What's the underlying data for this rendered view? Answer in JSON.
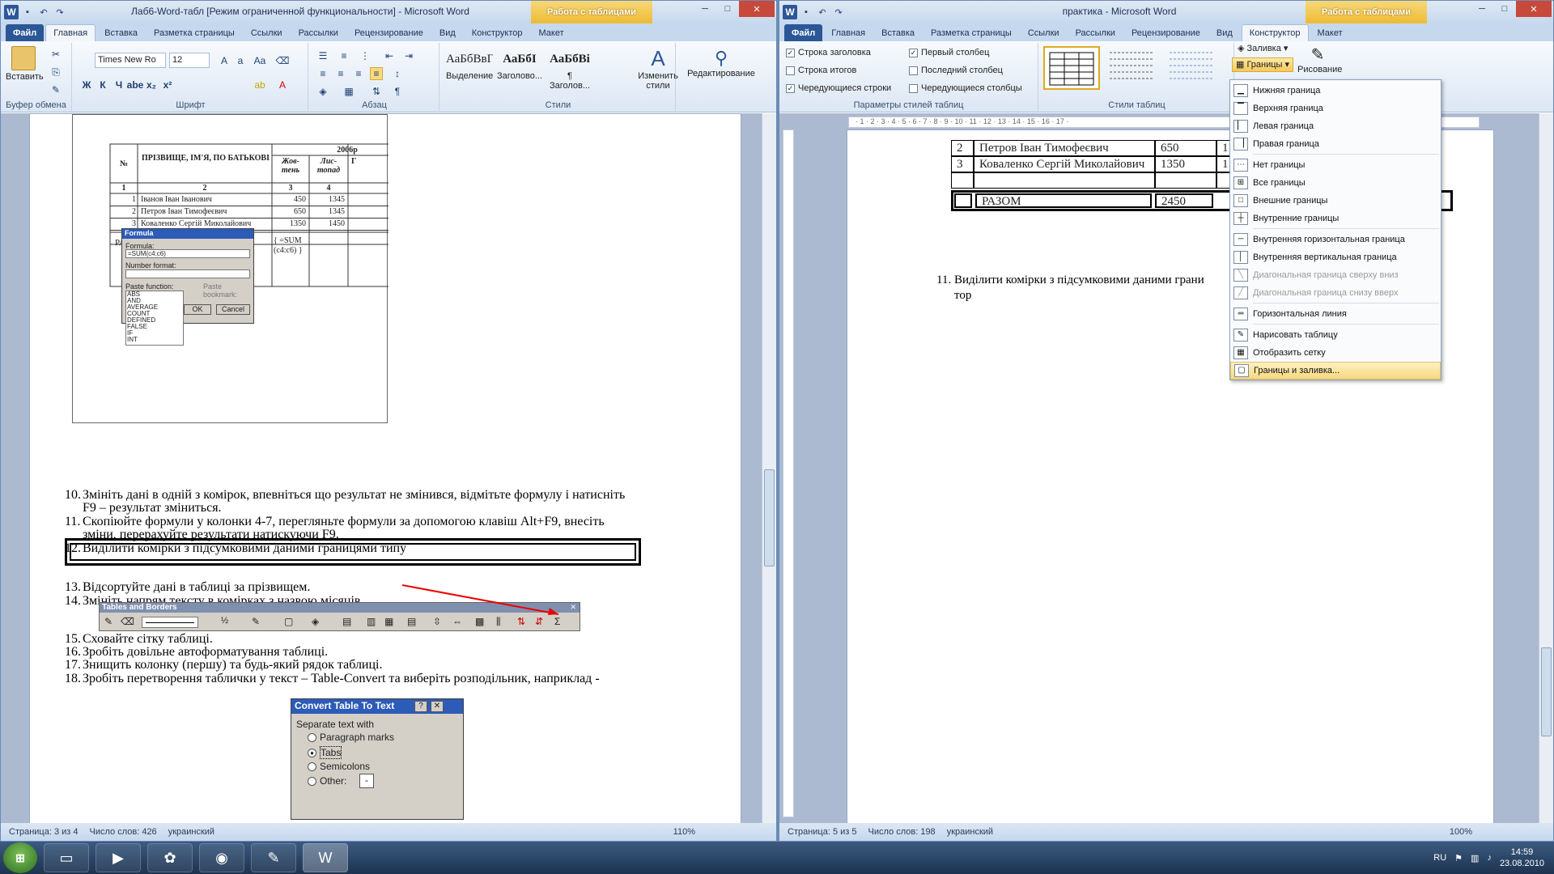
{
  "left": {
    "title": "Лаб6-Word-табл [Режим ограниченной функциональности] - Microsoft Word",
    "context_tab": "Работа с таблицами",
    "tabs": [
      "Файл",
      "Главная",
      "Вставка",
      "Разметка страницы",
      "Ссылки",
      "Рассылки",
      "Рецензирование",
      "Вид",
      "Конструктор",
      "Макет"
    ],
    "ribbon": {
      "paste": "Вставить",
      "clipboard_group": "Буфер обмена",
      "font_name": "Times New Ro",
      "font_size": "12",
      "font_group": "Шрифт",
      "paragraph_group": "Абзац",
      "styles_group": "Стили",
      "styles": [
        {
          "sample": "АаБбВвГ",
          "name": "Выделение"
        },
        {
          "sample": "АаБбІ",
          "name": "Заголово..."
        },
        {
          "sample": "АаБбВі",
          "name": "¶ Заголов..."
        }
      ],
      "change_styles": "Изменить стили",
      "editing": "Редактирование",
      "font_btns": [
        "Ж",
        "К",
        "Ч",
        "abe",
        "x₂",
        "x²"
      ]
    },
    "table": {
      "year": "2006р",
      "h_no": "№",
      "h_name": "ПРІЗВИЩЕ, ІМ'Я, ПО БАТЬКОВІ",
      "h_oct": "Жов-тень",
      "h_nov": "Лис-топад",
      "h_g": "Г",
      "nums": [
        "1",
        "2",
        "3",
        "4"
      ],
      "rows": [
        [
          "1",
          "Іванов Іван Іванович",
          "450",
          "1345"
        ],
        [
          "2",
          "Петров Іван Тимофеєвич",
          "650",
          "1345"
        ],
        [
          "3",
          "Коваленко Сергій Миколайович",
          "1350",
          "1450"
        ]
      ],
      "total": "РАЗОМ",
      "formula_field": "{ =SUM (c4:c6) }"
    },
    "formula_dialog": {
      "title": "Formula",
      "formula_label": "Formula:",
      "formula_value": "=SUM(c4:c6)",
      "number_format": "Number format:",
      "paste_function": "Paste function:",
      "paste_bookmark": "Paste bookmark:",
      "ok": "OK",
      "cancel": "Cancel",
      "functions": [
        "ABS",
        "AND",
        "AVERAGE",
        "COUNT",
        "DEFINED",
        "FALSE",
        "IF",
        "INT"
      ]
    },
    "steps": [
      {
        "n": "10.",
        "t": "Змініть дані в одній з комірок, впевніться що результат не змінився, відмітьте формулу і натисніть"
      },
      {
        "n": "",
        "t": "F9 – результат зміниться."
      },
      {
        "n": "11.",
        "t": "Скопіюйте формули у колонки 4-7, перегляньте формули за допомогою клавіш Alt+F9,  внесіть"
      },
      {
        "n": "",
        "t": "зміни, перерахуйте результати натискуючи F9."
      },
      {
        "n": "12.",
        "t": "Виділити комірки з підсумковими даними границями типу"
      },
      {
        "n": "13.",
        "t": "Відсортуйте дані в таблиці за прізвищем."
      },
      {
        "n": "14.",
        "t": "Змініть напрям тексту в комірках з назвою місяців."
      },
      {
        "n": "15.",
        "t": "Сховайте сітку таблиці."
      },
      {
        "n": "16.",
        "t": "Зробіть довільне автоформатування таблиці."
      },
      {
        "n": "17.",
        "t": "Знищить колонку (першу) та будь-який рядок таблиці."
      },
      {
        "n": "18.",
        "t": "Зробіть перетворення таблички  у текст – Table-Convert та виберіть розподільник, наприклад -"
      }
    ],
    "tables_borders": {
      "title": "Tables and Borders",
      "weight": "½"
    },
    "convert_dialog": {
      "title": "Convert Table To Text",
      "group": "Separate text with",
      "options": [
        "Paragraph marks",
        "Tabs",
        "Semicolons",
        "Other:"
      ],
      "selected": "Tabs",
      "other_value": "-"
    },
    "status": {
      "page": "Страница: 3 из 4",
      "words": "Число слов: 426",
      "lang": "украинский",
      "zoom": "110%"
    }
  },
  "right": {
    "title": "практика - Microsoft Word",
    "context_tab": "Работа с таблицами",
    "tabs": [
      "Файл",
      "Главная",
      "Вставка",
      "Разметка страницы",
      "Ссылки",
      "Рассылки",
      "Рецензирование",
      "Вид",
      "Конструктор",
      "Макет"
    ],
    "options": [
      "Строка заголовка",
      "Первый столбец",
      "Строка итогов",
      "Последний столбец",
      "Чередующиеся строки",
      "Чередующиеся столбцы"
    ],
    "options_checked": [
      true,
      true,
      false,
      false,
      true,
      false
    ],
    "options_group": "Параметры стилей таблиц",
    "styles_group": "Стили таблиц",
    "shading": "Заливка",
    "borders": "Границы",
    "draw": "Рисование",
    "ruler": "· 1 · 2 · 3 · 4 · 5 · 6 · 7 · 8 · 9 · 10 · 11 · 12 · 13 · 14 · 15 · 16 · 17 ·",
    "table_rows": [
      [
        "2",
        "Петров Іван Тимофеєвич",
        "650",
        "1"
      ],
      [
        "3",
        "Коваленко Сергій Миколайович",
        "1350",
        "1"
      ]
    ],
    "total": [
      "РАЗОМ",
      "2450"
    ],
    "step11": "11. Виділити комірки з підсумковими даними грани",
    "step11_cont": "тор",
    "menu": [
      {
        "label": "Нижняя граница",
        "icon": "▁",
        "dis": false
      },
      {
        "label": "Верхняя граница",
        "icon": "▔",
        "dis": false
      },
      {
        "label": "Левая граница",
        "icon": "▏",
        "dis": false
      },
      {
        "label": "Правая граница",
        "icon": "▕",
        "dis": false
      },
      {
        "label": "Нет границы",
        "icon": "⋯",
        "dis": false
      },
      {
        "label": "Все границы",
        "icon": "⊞",
        "dis": false
      },
      {
        "label": "Внешние границы",
        "icon": "□",
        "dis": false
      },
      {
        "label": "Внутренние границы",
        "icon": "┼",
        "dis": false
      },
      {
        "label": "Внутренняя горизонтальная граница",
        "icon": "─",
        "dis": false
      },
      {
        "label": "Внутренняя вертикальная граница",
        "icon": "│",
        "dis": false
      },
      {
        "label": "Диагональная граница сверху вниз",
        "icon": "╲",
        "dis": true
      },
      {
        "label": "Диагональная граница снизу вверх",
        "icon": "╱",
        "dis": true
      },
      {
        "label": "Горизонтальная линия",
        "icon": "═",
        "dis": false
      },
      {
        "label": "Нарисовать таблицу",
        "icon": "✎",
        "dis": false
      },
      {
        "label": "Отобразить сетку",
        "icon": "▦",
        "dis": false
      },
      {
        "label": "Границы и заливка...",
        "icon": "▢",
        "dis": false,
        "hl": true
      }
    ],
    "status": {
      "page": "Страница: 5 из 5",
      "words": "Число слов: 198",
      "lang": "украинский",
      "zoom": "100%"
    }
  },
  "taskbar": {
    "lang": "RU",
    "time": "14:59",
    "date": "23.08.2010"
  }
}
